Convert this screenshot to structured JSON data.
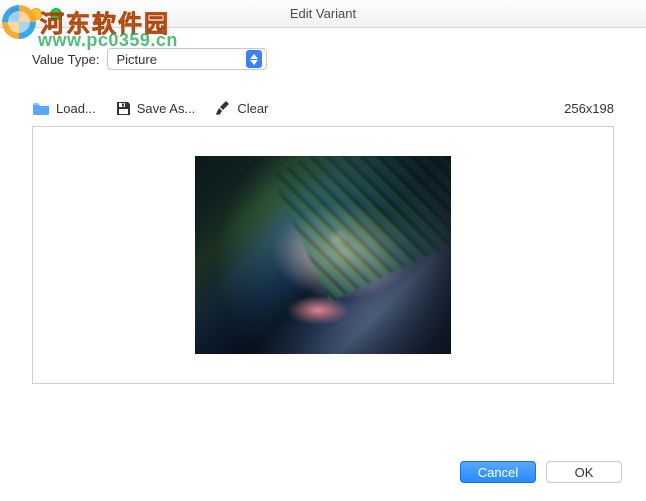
{
  "window": {
    "title": "Edit Variant"
  },
  "watermark": {
    "text": "河东软件园",
    "url": "www.pc0359.cn"
  },
  "form": {
    "value_type_label": "Value Type:",
    "value_type_selected": "Picture"
  },
  "toolbar": {
    "load_label": "Load...",
    "save_as_label": "Save As...",
    "clear_label": "Clear"
  },
  "preview": {
    "dimensions": "256x198"
  },
  "footer": {
    "cancel_label": "Cancel",
    "ok_label": "OK"
  }
}
